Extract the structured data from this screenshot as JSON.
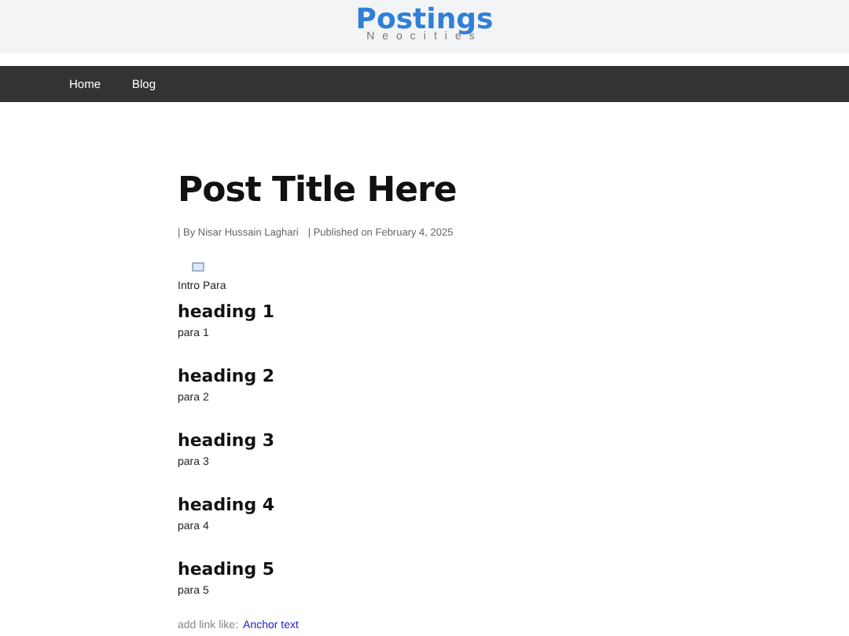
{
  "site": {
    "title": "Postings",
    "subtitle": "Neocities"
  },
  "nav": [
    {
      "label": "Home"
    },
    {
      "label": "Blog"
    }
  ],
  "post": {
    "title": "Post Title Here",
    "author": "| By Nisar Hussain Laghari",
    "published": "| Published on February 4, 2025",
    "intro": "Intro Para",
    "sections": [
      {
        "heading": "heading 1",
        "para": "para 1"
      },
      {
        "heading": "heading 2",
        "para": "para 2"
      },
      {
        "heading": "heading 3",
        "para": "para 3"
      },
      {
        "heading": "heading 4",
        "para": "para 4"
      },
      {
        "heading": "heading 5",
        "para": "para 5"
      }
    ],
    "link_prefix": "add link like:",
    "link_text": "Anchor text"
  }
}
